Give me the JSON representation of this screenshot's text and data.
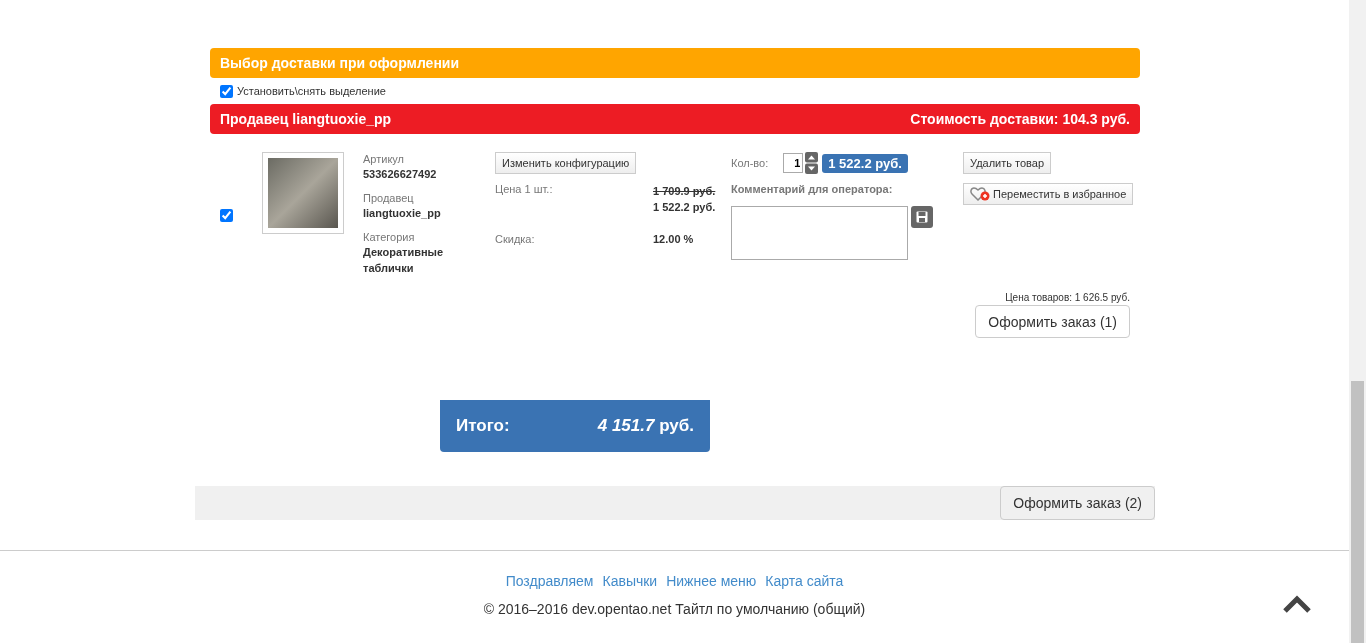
{
  "delivery_header": {
    "title": "Выбор доставки при оформлении"
  },
  "select_all": {
    "label": "Установить\\снять выделение",
    "checked": true
  },
  "seller_bar": {
    "title": "Продавец liangtuoxie_pp",
    "delivery_cost": "Стоимость доставки: 104.3 руб."
  },
  "item": {
    "checked": true,
    "specs": [
      {
        "label": "Артикул",
        "value": "533626627492"
      },
      {
        "label": "Продавец",
        "value": "liangtuoxie_pp"
      },
      {
        "label": "Категория",
        "value": "Декоративные таблички"
      }
    ],
    "config_button": "Изменить конфигурацию",
    "price_label": "Цена 1 шт.:",
    "old_price": "1 709.9 руб.",
    "price": "1 522.2 руб.",
    "discount_label": "Скидка:",
    "discount": "12.00 %",
    "qty_label": "Кол-во:",
    "qty": "1",
    "line_total": "1 522.2 руб.",
    "comment_label": "Комментарий для оператора:",
    "delete_button": "Удалить товар",
    "favorite_button": "Переместить в избранное"
  },
  "seller_summary": {
    "label": "Цена товаров:",
    "value": "1 626.5 руб.",
    "checkout_button": "Оформить заказ (1)"
  },
  "total": {
    "label": "Итого:",
    "value": "*4 151.7* руб."
  },
  "checkout_all_button": "Оформить заказ (2)",
  "footer": {
    "links": [
      "Поздравляем",
      "Кавычки",
      "Нижнее меню",
      "Карта сайта"
    ],
    "copyright": "© 2016–2016 dev.opentao.net Тайтл по умолчанию (общий)"
  }
}
